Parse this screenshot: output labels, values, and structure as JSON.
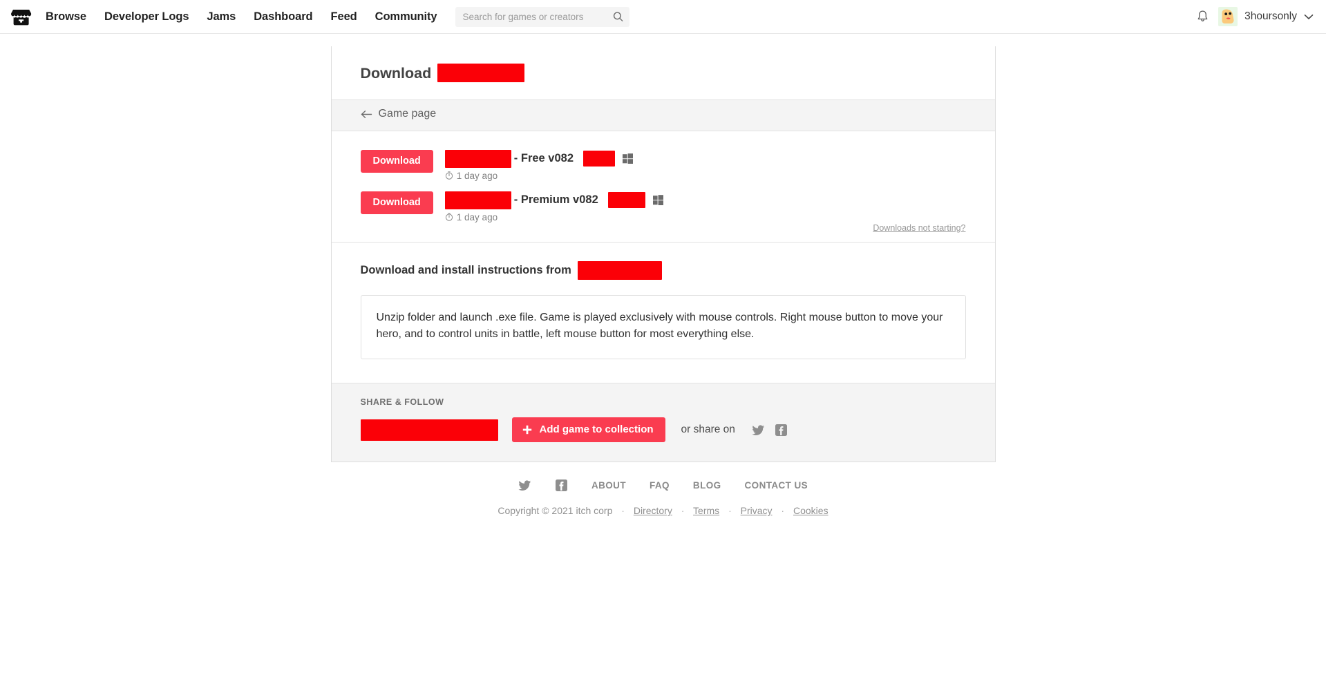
{
  "navbar": {
    "logo_icon": "itch-io-logo-icon",
    "links": [
      {
        "label": "Browse"
      },
      {
        "label": "Developer Logs"
      },
      {
        "label": "Jams"
      },
      {
        "label": "Dashboard"
      },
      {
        "label": "Feed"
      },
      {
        "label": "Community"
      }
    ],
    "search": {
      "placeholder": "Search for games or creators",
      "value": "",
      "icon": "search-icon"
    },
    "notifications_icon": "bell-icon",
    "user": {
      "name": "3hoursonly",
      "avatar_icon": "user-avatar",
      "caret_icon": "chevron-down-icon"
    }
  },
  "panel": {
    "title": "Download",
    "title_redacted": true,
    "back": {
      "label": "Game page",
      "icon": "arrow-left-icon"
    },
    "uploads": [
      {
        "button_label": "Download",
        "name_redacted": true,
        "name_suffix": "- Free v082",
        "size_redacted": true,
        "platform_icon": "windows-icon",
        "time_icon": "clock-icon",
        "time_label": "1 day ago"
      },
      {
        "button_label": "Download",
        "name_redacted": true,
        "name_suffix": "- Premium v082",
        "size_redacted": true,
        "platform_icon": "windows-icon",
        "time_icon": "clock-icon",
        "time_label": "1 day ago"
      }
    ],
    "not_starting_label": "Downloads not starting?",
    "instructions": {
      "heading": "Download and install instructions from",
      "heading_redacted": true,
      "body": "Unzip folder and launch .exe file. Game is played exclusively with mouse controls. Right mouse button to move your hero, and to control units in battle, left mouse button for most everything else."
    },
    "share": {
      "label": "SHARE & FOLLOW",
      "follow_redacted": true,
      "add_collection_label": "Add game to collection",
      "plus_icon": "plus-icon",
      "share_on_label": "or share on",
      "twitter_icon": "twitter-icon",
      "facebook_icon": "facebook-icon"
    }
  },
  "footer": {
    "twitter_icon": "twitter-icon",
    "facebook_icon": "facebook-icon",
    "links": [
      {
        "label": "ABOUT"
      },
      {
        "label": "FAQ"
      },
      {
        "label": "BLOG"
      },
      {
        "label": "CONTACT US"
      }
    ],
    "copyright": "Copyright © 2021 itch corp",
    "legal_links": [
      {
        "label": "Directory"
      },
      {
        "label": "Terms"
      },
      {
        "label": "Privacy"
      },
      {
        "label": "Cookies"
      }
    ],
    "separator": "·"
  },
  "colors": {
    "accent": "#fa3c50",
    "redaction": "#fb0007",
    "page_background": "#ffffff",
    "panel_background": "#ffffff",
    "muted_background": "#f4f4f4"
  }
}
